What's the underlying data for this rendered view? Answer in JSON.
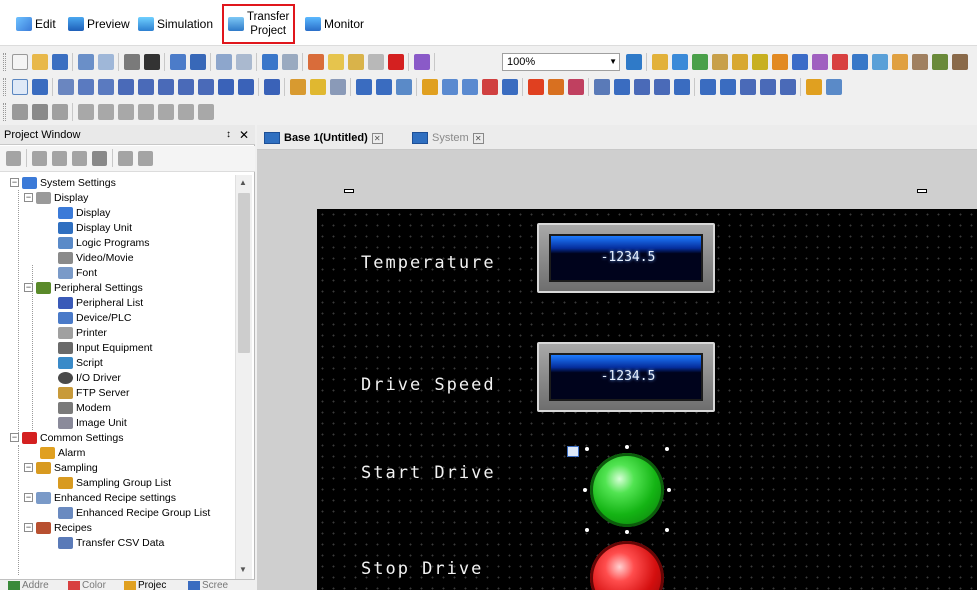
{
  "modes": {
    "edit": "Edit",
    "preview": "Preview",
    "simulation": "Simulation",
    "transfer_line1": "Transfer",
    "transfer_line2": "Project",
    "monitor": "Monitor"
  },
  "toolbar": {
    "zoom": "100%"
  },
  "project_window": {
    "title": "Project Window",
    "pin": "p",
    "close": "x",
    "tree": [
      "System Settings",
      "Display",
      "Display",
      "Display Unit",
      "Logic Programs",
      "Video/Movie",
      "Font",
      "Peripheral Settings",
      "Peripheral List",
      "Device/PLC",
      "Printer",
      "Input Equipment",
      "Script",
      "I/O Driver",
      "FTP Server",
      "Modem",
      "Image Unit",
      "Common Settings",
      "Alarm",
      "Sampling",
      "Sampling Group List",
      "Enhanced Recipe settings",
      "Enhanced Recipe Group List",
      "Recipes",
      "Transfer CSV Data"
    ],
    "bottom_tabs": [
      "Addre",
      "Color",
      "Projec",
      "Scree"
    ]
  },
  "editor": {
    "tabs": [
      "Base 1(Untitled)",
      "System"
    ],
    "labels": [
      "Temperature",
      "Drive Speed",
      "Start Drive",
      "Stop Drive"
    ],
    "display_values": [
      "-1234.5",
      "-1234.5"
    ]
  },
  "colors": {
    "transfer_highlight": "#e0161c",
    "canvas": "#000000",
    "lamp_start": "#14b414",
    "lamp_stop": "#d40f0f"
  }
}
